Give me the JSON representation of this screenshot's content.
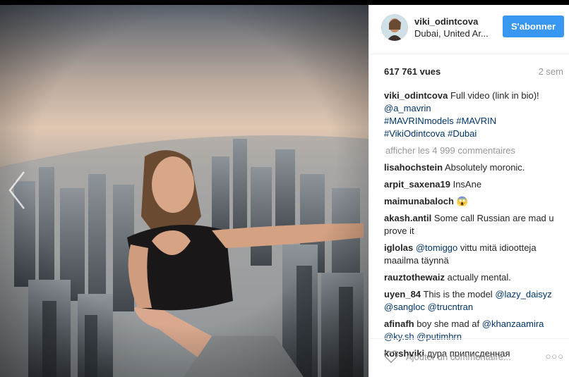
{
  "post": {
    "username": "viki_odintcova",
    "location": "Dubai, United Ar...",
    "follow_label": "S'abonner",
    "views": "617 761 vues",
    "time_ago": "2 sem",
    "caption": {
      "username": "viki_odintcova",
      "text": "Full video (link in bio)!",
      "mention": "@a_mavrin",
      "hashtags_1": "#MAVRINmodels #MAVRIN",
      "hashtags_2": "#VikiOdintcova #Dubai"
    },
    "load_more": "afficher les 4 999 commentaires",
    "comments": [
      {
        "user": "lisahochstein",
        "text": "Absolutely moronic."
      },
      {
        "user": "arpit_saxena19",
        "text": "InsAne"
      },
      {
        "user": "maimunabaloch",
        "text": "😱"
      },
      {
        "user": "akash.antil",
        "text": "Some call Russian are mad u prove it"
      },
      {
        "user": "iglolas",
        "m1": "@tomiggo",
        "text": "vittu mitä idiootteja maailma täynnä"
      },
      {
        "user": "rauztothewaiz",
        "text": "actually mental."
      },
      {
        "user": "uyen_84",
        "text": "This is the model",
        "m1": "@lazy_daisyz",
        "m2": "@sangloc",
        "m3": "@trucntran"
      },
      {
        "user": "afinafh",
        "text": "boy she mad af",
        "m1": "@khanzaamira",
        "m2": "@ky.sh",
        "m3": "@putimhrn"
      },
      {
        "user": "korshviki",
        "text": "дура приписденная"
      }
    ],
    "add_comment_placeholder": "Ajouter un commentaire...",
    "more_options": "○○○"
  },
  "colors": {
    "accent": "#3897f0",
    "link": "#003569",
    "text": "#262626",
    "muted": "#999999"
  },
  "icons": {
    "prev": "chevron-left-icon",
    "next": "chevron-right-icon",
    "like": "heart-outline-icon",
    "more": "more-options-icon"
  }
}
